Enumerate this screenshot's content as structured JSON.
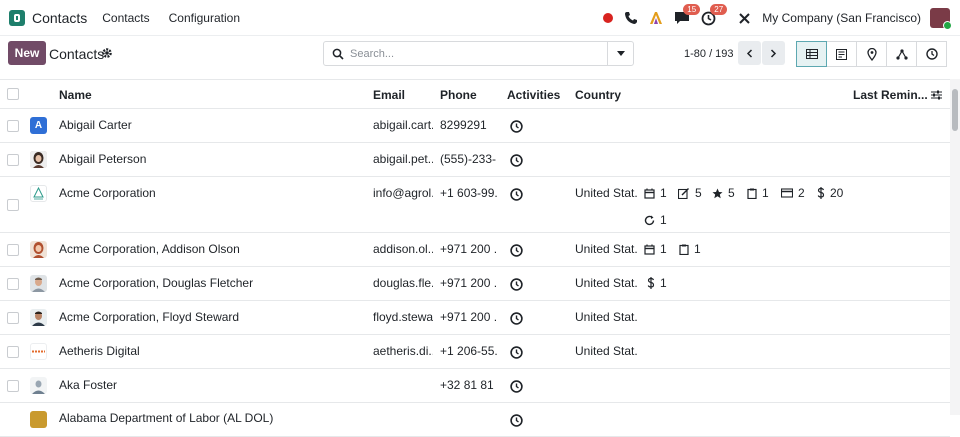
{
  "topbar": {
    "app_name": "Contacts",
    "nav": [
      "Contacts",
      "Configuration"
    ],
    "messages_badge": "15",
    "activities_badge": "27",
    "company": "My Company (San Francisco)"
  },
  "control": {
    "new_label": "New",
    "title": "Contacts",
    "search_placeholder": "Search...",
    "pager": "1-80 / 193"
  },
  "columns": {
    "name": "Name",
    "email": "Email",
    "phone": "Phone",
    "activities": "Activities",
    "country": "Country",
    "last_reminder": "Last Remin..."
  },
  "rows": [
    {
      "name": "Abigail Carter",
      "email": "abigail.cart...",
      "phone": "8299291",
      "country": ""
    },
    {
      "name": "Abigail Peterson",
      "email": "abigail.pet...",
      "phone": "(555)-233-...",
      "country": ""
    },
    {
      "name": "Acme Corporation",
      "email": "info@agrol...",
      "phone": "+1 603-99...",
      "country": "United Stat...",
      "stats": {
        "meetings": "1",
        "notes": "5",
        "favorites": "5",
        "tasks": "1",
        "cards": "2",
        "sales": "20",
        "refresh": "1"
      }
    },
    {
      "name": "Acme Corporation, Addison Olson",
      "email": "addison.ol...",
      "phone": "+971 200 ...",
      "country": "United Stat...",
      "stats": {
        "meetings": "1",
        "tasks": "1"
      }
    },
    {
      "name": "Acme Corporation, Douglas Fletcher",
      "email": "douglas.fle...",
      "phone": "+971 200 ...",
      "country": "United Stat...",
      "stats": {
        "sales": "1"
      }
    },
    {
      "name": "Acme Corporation, Floyd Steward",
      "email": "floyd.stewa...",
      "phone": "+971 200 ...",
      "country": "United Stat..."
    },
    {
      "name": "Aetheris Digital",
      "email": "aetheris.di...",
      "phone": "+1 206-55...",
      "country": "United Stat..."
    },
    {
      "name": "Aka Foster",
      "email": "",
      "phone": "+32 81 81 ...",
      "country": ""
    },
    {
      "name": "Alabama Department of Labor (AL DOL)",
      "email": "",
      "phone": "",
      "country": ""
    }
  ],
  "avatar_letter": "A",
  "colors": {
    "brand": "#714b67",
    "accent": "#017e84",
    "avatar_blue": "#2f6fd6"
  }
}
